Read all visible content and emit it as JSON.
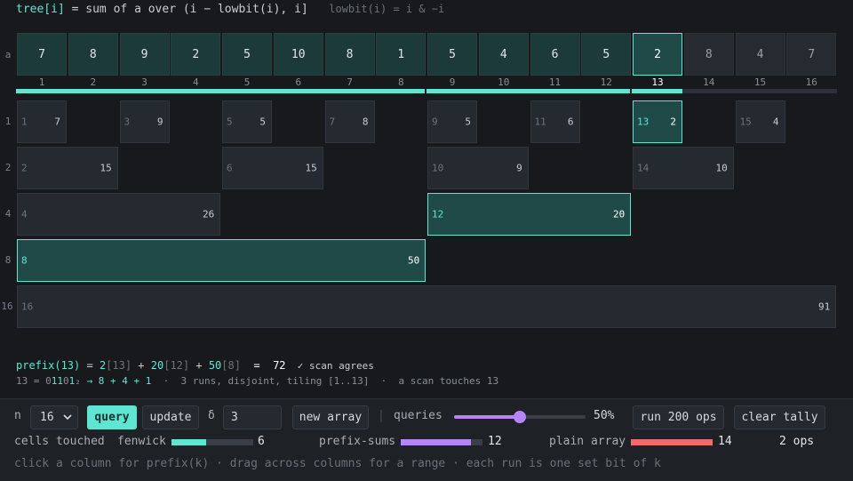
{
  "formula": {
    "lhs": "tree[i]",
    "rhs": " = sum of a over (i − lowbit(i), i]",
    "note": "lowbit(i) = i & −i"
  },
  "array": {
    "label": "a",
    "values": [
      "7",
      "8",
      "9",
      "2",
      "5",
      "10",
      "8",
      "1",
      "5",
      "4",
      "6",
      "5",
      "2",
      "8",
      "4",
      "7"
    ],
    "indices": [
      "1",
      "2",
      "3",
      "4",
      "5",
      "6",
      "7",
      "8",
      "9",
      "10",
      "11",
      "12",
      "13",
      "14",
      "15",
      "16"
    ],
    "selected": 13
  },
  "levels": [
    "1",
    "2",
    "4",
    "8",
    "16"
  ],
  "tree": [
    {
      "i": "1",
      "v": "7",
      "on": false
    },
    {
      "i": "3",
      "v": "9",
      "on": false
    },
    {
      "i": "5",
      "v": "5",
      "on": false
    },
    {
      "i": "7",
      "v": "8",
      "on": false
    },
    {
      "i": "9",
      "v": "5",
      "on": false
    },
    {
      "i": "11",
      "v": "6",
      "on": false
    },
    {
      "i": "13",
      "v": "2",
      "on": true
    },
    {
      "i": "15",
      "v": "4",
      "on": false
    },
    {
      "i": "2",
      "v": "15",
      "on": false
    },
    {
      "i": "6",
      "v": "15",
      "on": false
    },
    {
      "i": "10",
      "v": "9",
      "on": false
    },
    {
      "i": "14",
      "v": "10",
      "on": false
    },
    {
      "i": "4",
      "v": "26",
      "on": false
    },
    {
      "i": "12",
      "v": "20",
      "on": true
    },
    {
      "i": "8",
      "v": "50",
      "on": true
    },
    {
      "i": "16",
      "v": "91",
      "on": false
    }
  ],
  "sum": {
    "head": "prefix(13)",
    "eq": " = ",
    "t1": "2",
    "t1i": "[13]",
    "plus1": " + ",
    "t2": "20",
    "t2i": "[12]",
    "plus2": " + ",
    "t3": "50",
    "t3i": "[8]",
    "eq2": "  =  ",
    "total": "72",
    "check": "  ✓ scan agrees"
  },
  "bin": {
    "lead": "13 = ",
    "b0": "0",
    "b1": "11",
    "b2": "0",
    "b3": "1",
    "sub": "₂",
    "chain": " → 8 + 4 + 1",
    "rest": "  ·  3 runs, disjoint, tiling [1..13]  ·  a scan touches 13"
  },
  "controls": {
    "n_label": "n",
    "n_value": "16",
    "query": "query",
    "update": "update",
    "delta_label": "δ",
    "delta_value": "3",
    "new_array": "new array",
    "sep": "|",
    "queries_label": "queries",
    "queries_fraction": 0.5,
    "queries_pct": "50%",
    "run_ops": "run 200 ops",
    "clear_tally": "clear tally"
  },
  "tally": {
    "cells_label": "cells touched",
    "fenwick_label": "fenwick",
    "fenwick": "6",
    "prefix_label": "prefix-sums",
    "prefix": "12",
    "plain_label": "plain array",
    "plain": "14",
    "ops": "2 ops",
    "max": 14,
    "colors": {
      "fenwick": "#5ee6d3",
      "prefix": "#b784f5",
      "plain": "#f06b6b"
    }
  },
  "hint": "click a column for prefix(k) · drag across columns for a range · each run is one set bit of k"
}
